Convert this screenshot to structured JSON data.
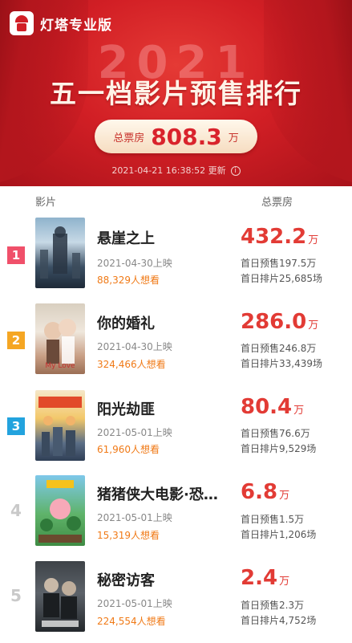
{
  "brand": {
    "name": "灯塔专业版"
  },
  "header": {
    "year": "2021",
    "title": "五一档影片预售排行",
    "box_office_label": "总票房",
    "box_office_value": "808.3",
    "box_office_unit": "万",
    "update_time": "2021-04-21 16:38:52 更新"
  },
  "columns": {
    "film": "影片",
    "gross": "总票房"
  },
  "films": [
    {
      "rank": "1",
      "name": "悬崖之上",
      "release": "2021-04-30上映",
      "want": "88,329人想看",
      "gross": "432.2",
      "unit": "万",
      "first_presale": "首日预售197.5万",
      "first_shows": "首日排片25,685场"
    },
    {
      "rank": "2",
      "name": "你的婚礼",
      "release": "2021-04-30上映",
      "want": "324,466人想看",
      "gross": "286.0",
      "unit": "万",
      "first_presale": "首日预售246.8万",
      "first_shows": "首日排片33,439场"
    },
    {
      "rank": "3",
      "name": "阳光劫匪",
      "release": "2021-05-01上映",
      "want": "61,960人想看",
      "gross": "80.4",
      "unit": "万",
      "first_presale": "首日预售76.6万",
      "first_shows": "首日排片9,529场"
    },
    {
      "rank": "4",
      "name": "猪猪侠大电影·恐…",
      "release": "2021-05-01上映",
      "want": "15,319人想看",
      "gross": "6.8",
      "unit": "万",
      "first_presale": "首日预售1.5万",
      "first_shows": "首日排片1,206场"
    },
    {
      "rank": "5",
      "name": "秘密访客",
      "release": "2021-05-01上映",
      "want": "224,554人想看",
      "gross": "2.4",
      "unit": "万",
      "first_presale": "首日预售2.3万",
      "first_shows": "首日排片4,752场"
    }
  ],
  "colors": {
    "accent": "#e23b35",
    "want": "#f07a17",
    "rank1": "#f0506a",
    "rank2": "#f5a623",
    "rank3": "#23a3de"
  }
}
